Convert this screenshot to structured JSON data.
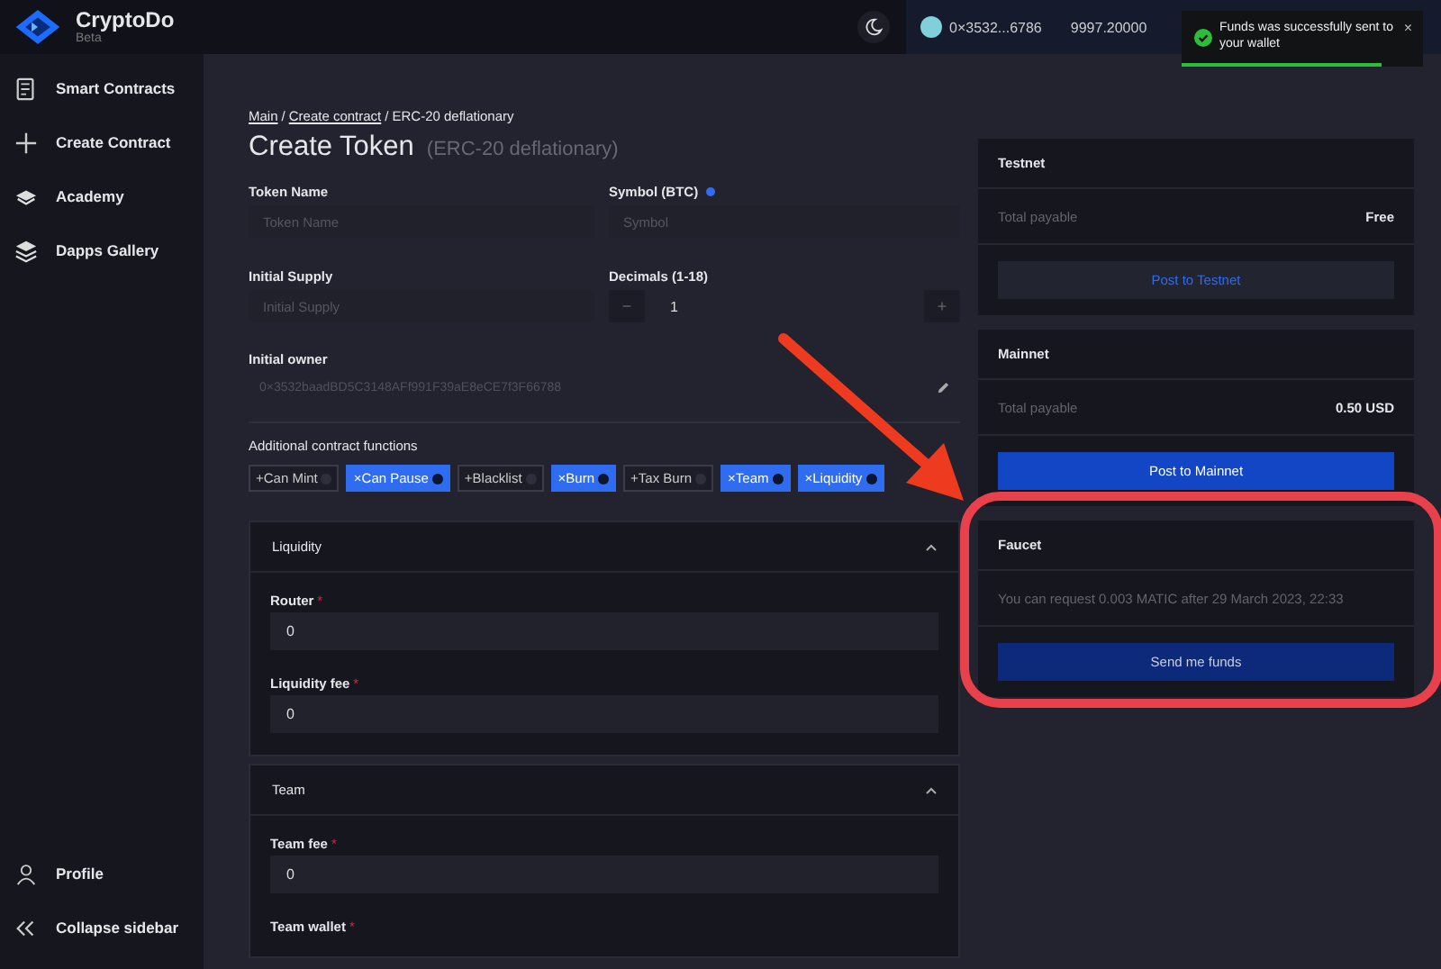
{
  "app": {
    "name": "CryptoDo",
    "badge": "Beta"
  },
  "header": {
    "wallet_address": "0×3532...6786",
    "balance": "9997.20000"
  },
  "toast": {
    "message": "Funds was successfully sent to your wallet",
    "close": "×",
    "level": 0.83
  },
  "sidebar": {
    "items": [
      {
        "label": "Smart Contracts",
        "kind": "contracts"
      },
      {
        "label": "Create Contract",
        "kind": "plus"
      },
      {
        "label": "Academy",
        "kind": "academy"
      },
      {
        "label": "Dapps Gallery",
        "kind": "layers"
      }
    ],
    "footer": [
      {
        "label": "Profile",
        "kind": "profile"
      },
      {
        "label": "Collapse sidebar",
        "kind": "collapse"
      }
    ]
  },
  "breadcrumb": [
    {
      "label": "Main",
      "link": true
    },
    {
      "label": "Create contract",
      "link": true
    },
    {
      "label": "ERC-20 deflationary",
      "link": false
    }
  ],
  "breadcrumb_separator": "/",
  "title": "Create Token",
  "subtitle": "(ERC-20 deflationary)",
  "fields": {
    "token_name": {
      "label": "Token Name",
      "placeholder": "Token Name"
    },
    "symbol": {
      "label": "Symbol (BTC)",
      "placeholder": "Symbol"
    },
    "initial_supply": {
      "label": "Initial Supply",
      "placeholder": "Initial Supply"
    },
    "decimals": {
      "label": "Decimals (1-18)",
      "value": "1",
      "minus": "−",
      "plus": "+"
    },
    "initial_owner": {
      "label": "Initial owner",
      "value": "0×3532baadBD5C3148AFf991F39aE8eCE7f3F66788"
    }
  },
  "functions": {
    "title": "Additional contract functions",
    "tags": [
      {
        "label": "+Can Mint",
        "selected": false
      },
      {
        "label": "×Can Pause",
        "selected": true
      },
      {
        "label": "+Blacklist",
        "selected": false
      },
      {
        "label": "×Burn",
        "selected": true
      },
      {
        "label": "+Tax Burn",
        "selected": false
      },
      {
        "label": "×Team",
        "selected": true
      },
      {
        "label": "×Liquidity",
        "selected": true
      }
    ]
  },
  "sections": [
    {
      "title": "Liquidity",
      "expanded": true,
      "fields": [
        {
          "label": "Router",
          "required": true,
          "value": "0"
        },
        {
          "label": "Liquidity fee",
          "required": true,
          "value": "0"
        }
      ]
    },
    {
      "title": "Team",
      "expanded": true,
      "fields": [
        {
          "label": "Team fee",
          "required": true,
          "value": "0"
        },
        {
          "label": "Team wallet",
          "required": true
        }
      ]
    }
  ],
  "required_mark": "*",
  "cards": [
    {
      "title": "Testnet",
      "row_label": "Total payable",
      "row_value": "Free",
      "button": "Post to Testnet",
      "primary": false
    },
    {
      "title": "Mainnet",
      "row_label": "Total payable",
      "row_value": "0.50 USD",
      "button": "Post to Mainnet",
      "primary": true
    },
    {
      "title": "Faucet",
      "text": "You can request 0.003 MATIC after 29 March 2023, 22:33",
      "button": "Send me funds",
      "primary": false,
      "highlighted": true
    }
  ]
}
